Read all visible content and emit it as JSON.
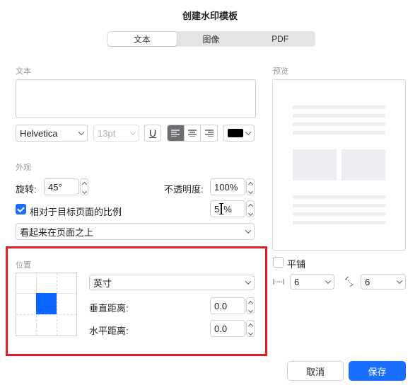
{
  "dialog": {
    "title": "创建水印模板"
  },
  "tabs": [
    {
      "label": "文本",
      "active": true
    },
    {
      "label": "图像"
    },
    {
      "label": "PDF"
    }
  ],
  "text_section": {
    "label": "文本",
    "value": ""
  },
  "font": {
    "family": "Helvetica",
    "size": "13pt",
    "color": "#000000"
  },
  "format": {
    "underline_label": "U",
    "alignment": "left"
  },
  "appearance": {
    "label": "外观",
    "rotation_label": "旋转:",
    "rotation_value": "45°",
    "opacity_label": "不透明度:",
    "opacity_value": "100%",
    "relative_scale_label": "相对于目标页面的比例",
    "relative_scale_checked": true,
    "scale_value": "5",
    "scale_unit": "%",
    "layer_option": "看起来在页面之上"
  },
  "position": {
    "label": "位置",
    "unit": "英寸",
    "vertical_label": "垂直距离:",
    "vertical_value": "0.0",
    "horizontal_label": "水平距离:",
    "horizontal_value": "0.0",
    "selected_cell": "center"
  },
  "preview": {
    "label": "预览"
  },
  "tile": {
    "label": "平铺",
    "checked": false,
    "horizontal_spacing": "6",
    "vertical_spacing": "6"
  },
  "buttons": {
    "cancel": "取消",
    "save": "保存"
  },
  "colors": {
    "accent": "#1a6fff",
    "highlight_box": "#e31d25",
    "position_square": "#0a66ff"
  }
}
